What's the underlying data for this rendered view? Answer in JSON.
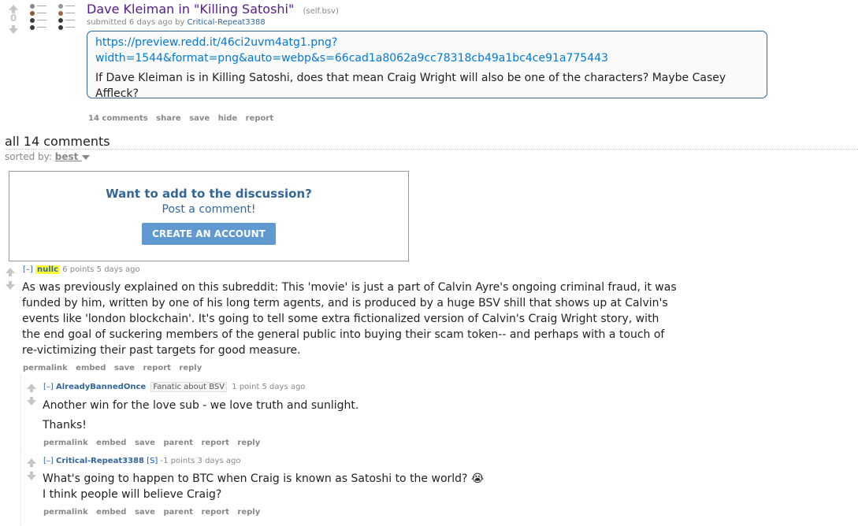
{
  "post": {
    "score": "0",
    "title": "Dave Kleiman in \"Killing Satoshi\"",
    "domain": "(self.bsv)",
    "submitted_prefix": "submitted 6 days ago by",
    "author": "Critical-Repeat3388",
    "link_line1": "https://preview.redd.it/46ci2uvm4atg1.png?",
    "link_line2": "width=1544&format=png&auto=webp&s=66cad1a8062a9cc78318cb49a1bc4ce91a775443",
    "body_line1": "If Dave Kleiman is in Killing Satoshi, does that mean Craig Wright will also be one of the characters? Maybe Casey",
    "body_line2": "Affleck?",
    "actions": [
      "14 comments",
      "share",
      "save",
      "hide",
      "report"
    ]
  },
  "comments_header": {
    "title": "all 14 comments",
    "sorted_label": "sorted by:",
    "sorted_value": "best"
  },
  "cta": {
    "heading": "Want to add to the discussion?",
    "sub": "Post a comment!",
    "button": "CREATE AN ACCOUNT"
  },
  "comments": [
    {
      "toggle": "[–]",
      "author": "nullc",
      "meta": "6 points 5 days ago",
      "lines": [
        "As was previously explained on this subreddit: This 'movie' is just a part of Calvin Ayre's ongoing criminal fraud, it was",
        "funded by him, written by one of his long term agents, and is produced by a huge BSV shill that shows up at Calvin's",
        "events like 'london blockchain'. It's going to tell some extra fictionalized version of Calvin's Craig Wright story, with",
        "the end goal of suckering members of the general public into buying their scam token-- and perhaps with a touch of",
        "re-victimizing their past targets for good measure."
      ],
      "actions": [
        "permalink",
        "embed",
        "save",
        "report",
        "reply"
      ]
    },
    {
      "toggle": "[–]",
      "author": "AlreadyBannedOnce",
      "flair": "Fanatic about BSV",
      "meta": "1 point 5 days ago",
      "lines": [
        "Another win for the love sub - we love truth and sunlight.",
        "Thanks!"
      ],
      "actions": [
        "permalink",
        "embed",
        "save",
        "parent",
        "report",
        "reply"
      ]
    },
    {
      "toggle": "[–]",
      "author": "Critical-Repeat3388",
      "submitter_tag": "[S]",
      "meta": "-1 points 3 days ago",
      "lines": [
        "What's going to happen to BTC when Craig is known as Satoshi to the world?",
        "I think people will believe Craig?"
      ],
      "emoji": "😭",
      "actions": [
        "permalink",
        "embed",
        "save",
        "parent",
        "report",
        "reply"
      ]
    }
  ],
  "colors": {
    "title_link": "#551a8b",
    "author_blue": "#369",
    "cta_button": "#5f99cf",
    "highlight": "#ffff33"
  }
}
